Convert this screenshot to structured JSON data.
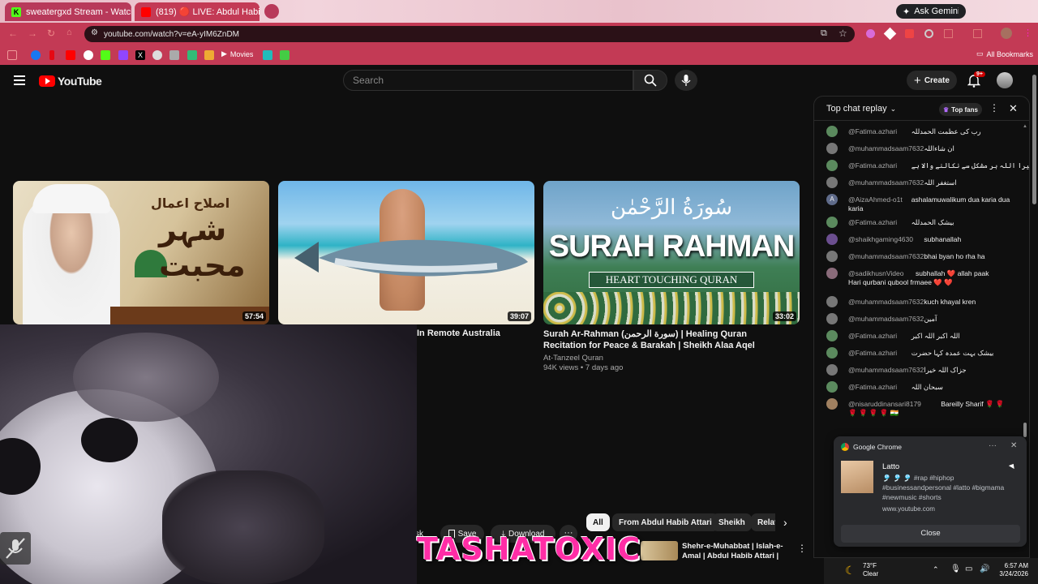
{
  "tabs": [
    {
      "title": "sweatergxd Stream - Watch Liv",
      "fav_color": "#53fc18",
      "bg": "#b8395a"
    },
    {
      "title": "(819) 🔴 LIVE: Abdul Habib Atta",
      "fav_color": "#ff0000",
      "bg": "#c33a55"
    }
  ],
  "gemini_label": "Ask Gemini",
  "url": "youtube.com/watch?v=eA-yIM6ZnDM",
  "bookmarks": {
    "movies_label": "Movies",
    "all_label": "All Bookmarks"
  },
  "header": {
    "logo": "YouTube",
    "search_placeholder": "Search",
    "create_label": "Create",
    "notif_count": "9+"
  },
  "videos": [
    {
      "duration": "57:54",
      "title": "",
      "channel": "",
      "meta": ""
    },
    {
      "duration": "39:07",
      "title": "In Remote Australia",
      "channel": "",
      "meta": ""
    },
    {
      "duration": "33:02",
      "title": "Surah Ar-Rahman (سورة الرحمن) | Healing Quran Recitation for Peace & Barakah | Sheikh Alaa Aqel",
      "channel": "At-Tanzeel Quran",
      "meta": "94K views • 7 days ago"
    }
  ],
  "thumb_text": {
    "v1_top": "اصلاح اعمال",
    "v1_main": "شہر محبت",
    "v3_arabic": "سُورَةُ الرَّحْمٰن",
    "v3_title": "SURAH RAHMAN",
    "v3_sub": "HEART TOUCHING QURAN"
  },
  "actions": {
    "ask": "sk",
    "save": "Save",
    "download": "Download"
  },
  "chips": [
    "All",
    "From Abdul Habib Attari",
    "Sheikh",
    "Relat"
  ],
  "related": {
    "title_line1": "Shehr-e-Muhabbat | Islah-e-",
    "title_line2": "Amal | Abdul Habib Attari |"
  },
  "overlay_banner": "TASHATOXIC",
  "chat": {
    "title": "Top chat replay",
    "top_fans": "Top fans",
    "messages": [
      {
        "author": "@Fatima.azhari",
        "text": "رب کی عظمت الحمدللہ",
        "color": "#5b8a5e"
      },
      {
        "author": "@muhammadsaam7632",
        "text": "ان شاءاللہ",
        "color": "#777"
      },
      {
        "author": "@Fatima.azhari",
        "text": "میرا اللہ ہر مشکل سے نکالنے والا ہے",
        "color": "#5b8a5e"
      },
      {
        "author": "@muhammadsaam7632",
        "text": "استغفر اللہ",
        "color": "#777"
      },
      {
        "author": "@AizaAhmed-o1t",
        "text": "ashalamuwalikum dua karia dua",
        "text2": "karia",
        "color": "#5f6b8a",
        "initial": "A"
      },
      {
        "author": "@Fatima.azhari",
        "text": "بیشک الحمدللہ",
        "color": "#5b8a5e"
      },
      {
        "author": "@shaikhgaming4630",
        "text": "subhanallah",
        "color": "#6b4e8f"
      },
      {
        "author": "@muhammadsaam7632",
        "text": "bhai byan ho rha ha",
        "color": "#777"
      },
      {
        "author": "@sadikhusnVideo",
        "text": "subhallah ❤️ allah paak",
        "text2": "Hari qurbani qubool frmaee ❤️ ❤️",
        "color": "#8a6b7a"
      },
      {
        "author": "@muhammadsaam7632",
        "text": "kuch khayal kren",
        "color": "#777"
      },
      {
        "author": "@muhammadsaam7632",
        "text": "آمین",
        "color": "#777"
      },
      {
        "author": "@Fatima.azhari",
        "text": "اللہ اکبر اللہ اکبر",
        "color": "#5b8a5e"
      },
      {
        "author": "@Fatima.azhari",
        "text": "بیشک بہت عمدہ کہا حضرت",
        "color": "#5b8a5e"
      },
      {
        "author": "@muhammadsaam7632",
        "text": "جزاک اللہ خیرا",
        "color": "#777"
      },
      {
        "author": "@Fatima.azhari",
        "text": "سبحان اللہ",
        "color": "#5b8a5e"
      },
      {
        "author": "@nisaruddinansari8179",
        "text": "Bareilly Sharif 🌹 🌹",
        "text2": "🌹 🌹 🌹 🌹 🇮🇳",
        "color": "#a08060"
      }
    ]
  },
  "notification": {
    "app": "Google Chrome",
    "title": "Latto",
    "line1": "🎐 🎐 🎐 #rap #hiphop",
    "line2": "#businessandpersonal #latto #bigmama",
    "line3": "#newmusic #shorts",
    "site": "www.youtube.com",
    "close": "Close"
  },
  "taskbar": {
    "temp": "73°F",
    "weather": "Clear",
    "time": "6:57 AM",
    "date": "3/24/2026"
  }
}
